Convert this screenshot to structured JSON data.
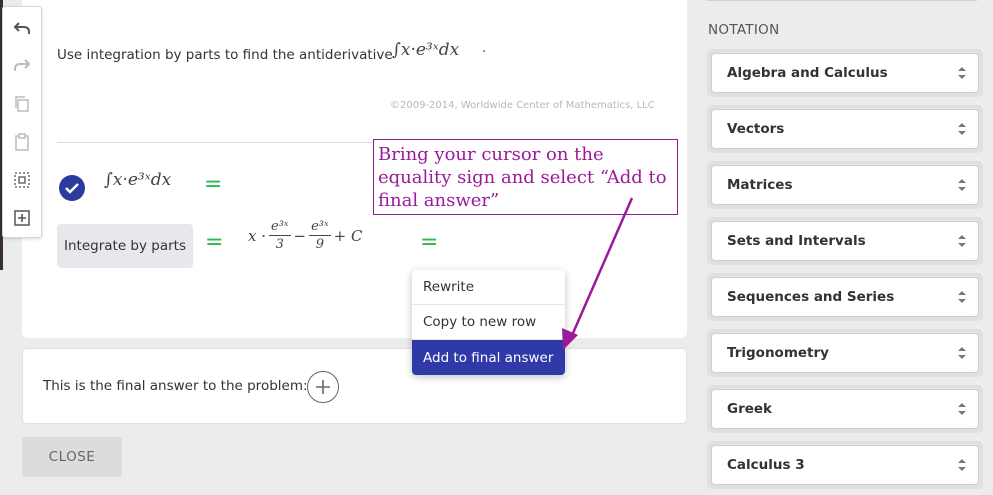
{
  "problem": {
    "instruction": "Use integration by parts to find the antiderivative",
    "expression": "∫x·e³ˣdx",
    "trailing": ".",
    "copyright": "©2009-2014, Worldwide Center of Mathematics, LLC"
  },
  "steps": [
    {
      "expression": "∫x·e³ˣdx",
      "equals": "="
    },
    {
      "label": "Integrate by parts",
      "equals_left": "=",
      "result": {
        "x_term": "x ·",
        "frac1_num": "e³ˣ",
        "frac1_den": "3",
        "minus": "−",
        "frac2_num": "e³ˣ",
        "frac2_den": "9",
        "constant": "+ C"
      },
      "equals_right": "="
    }
  ],
  "annotation": {
    "text": "Bring your cursor on the equality sign and select “Add to final answer”",
    "color": "#9a1a9a"
  },
  "context_menu": {
    "items": [
      "Rewrite",
      "Copy to new row",
      "Add to final answer"
    ],
    "active_index": 2,
    "active_color": "#2f3aa8"
  },
  "final_answer": {
    "prompt": "This is the final answer to the problem:"
  },
  "buttons": {
    "close": "CLOSE"
  },
  "sidebar": {
    "title": "NOTATION",
    "categories": [
      "Algebra and Calculus",
      "Vectors",
      "Matrices",
      "Sets and Intervals",
      "Sequences and Series",
      "Trigonometry",
      "Greek",
      "Calculus 3"
    ]
  },
  "toolbar": {
    "icons": [
      "undo-icon",
      "redo-icon",
      "copy-icon",
      "paste-icon",
      "select-all-icon",
      "insert-row-icon"
    ]
  },
  "colors": {
    "accent": "#2d3a9e",
    "equals": "#2db84c",
    "annotation": "#9a1a9a"
  }
}
